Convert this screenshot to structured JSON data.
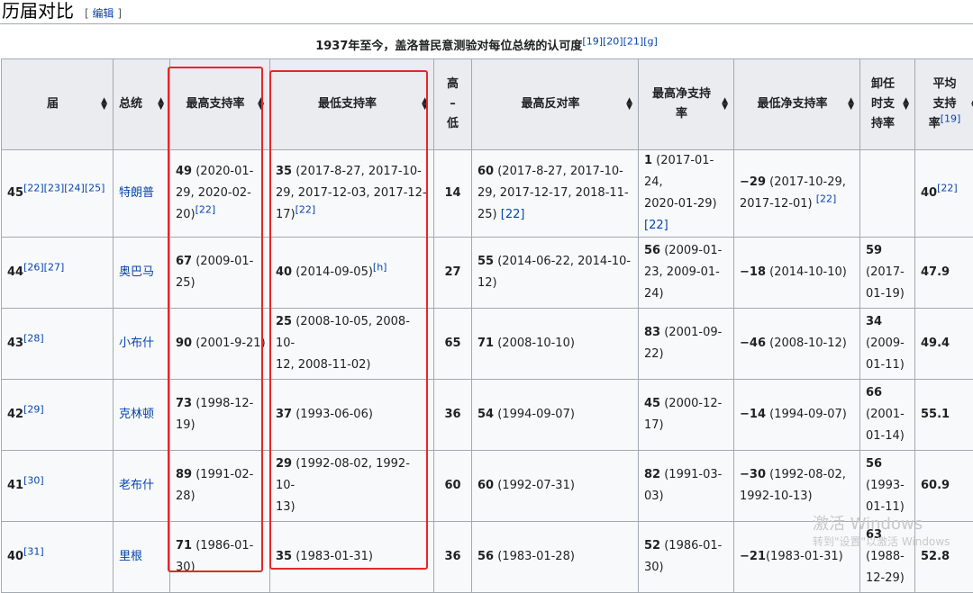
{
  "section": {
    "title": "历届对比",
    "edit_open": "[",
    "edit_label": "编辑",
    "edit_close": "]"
  },
  "caption": {
    "text": "1937年至今，盖洛普民意测验对每位总统的认可度",
    "refs": [
      "[19]",
      "[20]",
      "[21]",
      "[g]"
    ]
  },
  "headers": {
    "term": "届",
    "president": "总统",
    "highest": "最高支持率",
    "lowest": "最低支持率",
    "gap_1": "高",
    "gap_2": "–",
    "gap_3": "低",
    "highest_disapproval": "最高反对率",
    "highest_net_1": "最高净支持",
    "highest_net_2": "率",
    "lowest_net": "最低净支持率",
    "exit_1": "卸任",
    "exit_2": "时支",
    "exit_3": "持率",
    "avg_1": "平均",
    "avg_2": "支持",
    "avg_3": "率",
    "avg_ref": "[19]"
  },
  "rows": [
    {
      "term": "45",
      "term_refs": "[22][23][24][25]",
      "president": "特朗普",
      "high": "49",
      "high_date_1": " (2020-01-",
      "high_date_2": "29, 2020-02-",
      "high_date_3": "20)",
      "high_ref": "[22]",
      "low": "35",
      "low_date_1": " (2017-8-27, 2017-10-",
      "low_date_2": "29, 2017-12-03, 2017-12-",
      "low_date_3": "17)",
      "low_ref": "[22]",
      "gap": "14",
      "dis": "60",
      "dis_date_1": " (2017-8-27, 2017-10-",
      "dis_date_2": "29, 2017-12-17, 2018-11-",
      "dis_date_3": "25)",
      "dis_ref": "[22]",
      "hnet": "1",
      "hnet_date_1": " (2017-01-24,",
      "hnet_date_2": "2020-01-29)",
      "hnet_ref": "[22]",
      "lnet": "−29",
      "lnet_date_1": " (2017-10-29,",
      "lnet_date_2": "2017-12-01)",
      "lnet_ref": "[22]",
      "avg": "40",
      "avg_ref": "[22]"
    },
    {
      "term": "44",
      "term_refs": "[26][27]",
      "president": "奥巴马",
      "high": "67",
      "high_date_1": " (2009-01-",
      "high_date_2": "25)",
      "low": "40",
      "low_date": " (2014-09-05)",
      "low_ref": "[h]",
      "gap": "27",
      "dis": "55",
      "dis_date_1": " (2014-06-22, 2014-10-",
      "dis_date_2": "12)",
      "hnet": "56",
      "hnet_date_1": " (2009-01-",
      "hnet_date_2": "23, 2009-01-",
      "hnet_date_3": "24)",
      "lnet": "−18",
      "lnet_date": " (2014-10-10)",
      "exit": "59",
      "exit_date_1": "(2017-",
      "exit_date_2": "01-19)",
      "avg": "47.9"
    },
    {
      "term": "43",
      "term_refs": "[28]",
      "president": "小布什",
      "high": "90",
      "high_date": " (2001-9-21)",
      "low": "25",
      "low_date_1": " (2008-10-05, 2008-10-",
      "low_date_2": "12, 2008-11-02)",
      "gap": "65",
      "dis": "71",
      "dis_date": " (2008-10-10)",
      "hnet": "83",
      "hnet_date_1": " (2001-09-",
      "hnet_date_2": "22)",
      "lnet": "−46",
      "lnet_date": " (2008-10-12)",
      "exit": "34",
      "exit_date_1": "(2009-",
      "exit_date_2": "01-11)",
      "avg": "49.4"
    },
    {
      "term": "42",
      "term_refs": "[29]",
      "president": "克林顿",
      "high": "73",
      "high_date_1": " (1998-12-",
      "high_date_2": "19)",
      "low": "37",
      "low_date": " (1993-06-06)",
      "gap": "36",
      "dis": "54",
      "dis_date": " (1994-09-07)",
      "hnet": "45",
      "hnet_date_1": " (2000-12-",
      "hnet_date_2": "17)",
      "lnet": "−14",
      "lnet_date": " (1994-09-07)",
      "exit": "66",
      "exit_date_1": "(2001-",
      "exit_date_2": "01-14)",
      "avg": "55.1"
    },
    {
      "term": "41",
      "term_refs": "[30]",
      "president": "老布什",
      "high": "89",
      "high_date_1": " (1991-02-",
      "high_date_2": "28)",
      "low": "29",
      "low_date_1": " (1992-08-02, 1992-10-",
      "low_date_2": "13)",
      "gap": "60",
      "dis": "60",
      "dis_date": " (1992-07-31)",
      "hnet": "82",
      "hnet_date_1": " (1991-03-",
      "hnet_date_2": "03)",
      "lnet": "−30",
      "lnet_date_1": " (1992-08-02,",
      "lnet_date_2": "1992-10-13)",
      "exit": "56",
      "exit_date_1": "(1993-",
      "exit_date_2": "01-11)",
      "avg": "60.9"
    },
    {
      "term": "40",
      "term_refs": "[31]",
      "president": "里根",
      "high": "71",
      "high_date_1": " (1986-01-",
      "high_date_2": "30)",
      "low": "35",
      "low_date": " (1983-01-31)",
      "gap": "36",
      "dis": "56",
      "dis_date": " (1983-01-28)",
      "hnet": "52",
      "hnet_date_1": " (1986-01-",
      "hnet_date_2": "30)",
      "lnet": "−21",
      "lnet_date": "(1983-01-31)",
      "exit": "63",
      "exit_date_1": "(1988-",
      "exit_date_2": "12-29)",
      "avg": "52.8"
    }
  ],
  "watermark": {
    "line1": "激活 Windows",
    "line2": "转到\"设置\"以激活 Windows"
  },
  "colors": {
    "header_bg": "#eaecf0",
    "cell_bg": "#f8f9fa",
    "border": "#a2a9b1",
    "link": "#0645ad",
    "highlight_box": "#e6262a"
  }
}
